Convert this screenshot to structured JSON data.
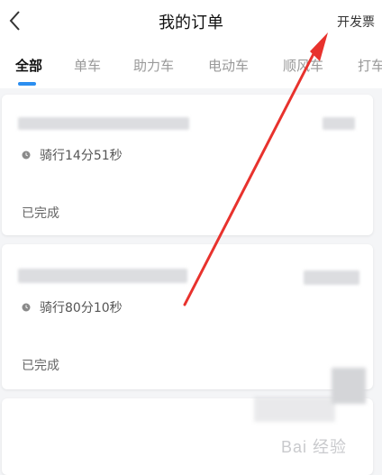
{
  "header": {
    "title": "我的订单",
    "invoice_label": "开发票"
  },
  "tabs": [
    {
      "label": "全部",
      "active": true
    },
    {
      "label": "单车",
      "active": false
    },
    {
      "label": "助力车",
      "active": false
    },
    {
      "label": "电动车",
      "active": false
    },
    {
      "label": "顺风车",
      "active": false
    },
    {
      "label": "打车",
      "active": false
    }
  ],
  "orders": [
    {
      "duration": "骑行14分51秒",
      "status": "已完成"
    },
    {
      "duration": "骑行80分10秒",
      "status": "已完成"
    }
  ],
  "watermark": {
    "text": "Bai 经验"
  },
  "colors": {
    "accent": "#2b8ef0",
    "annotation_arrow": "#e8322d",
    "background": "#f4f5f7"
  },
  "icons": {
    "back": "chevron-left-icon",
    "clock": "clock-icon"
  }
}
